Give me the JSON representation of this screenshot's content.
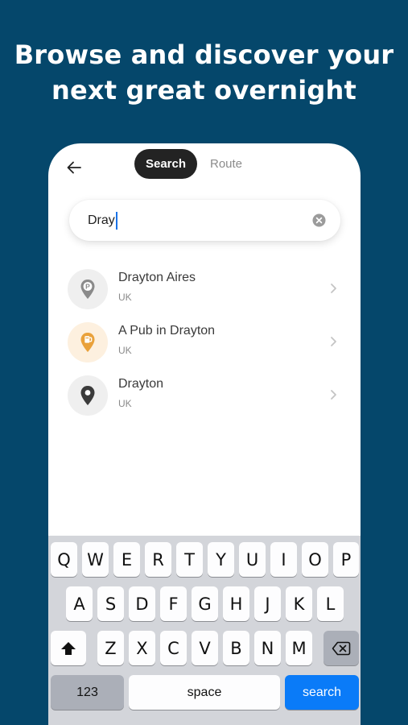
{
  "headline": {
    "line1": "Browse and discover your",
    "line2": "next great overnight"
  },
  "header": {
    "tabs": [
      {
        "label": "Search",
        "active": true
      },
      {
        "label": "Route",
        "active": false
      }
    ]
  },
  "search": {
    "value": "Dray"
  },
  "results": [
    {
      "title": "Drayton Aires",
      "subtitle": "UK",
      "icon": "parking-pin-icon",
      "bg": "#efefef",
      "color": "#8a8a8a"
    },
    {
      "title": "A Pub in Drayton",
      "subtitle": "UK",
      "icon": "pub-pin-icon",
      "bg": "#fdf0df",
      "color": "#e9a13b"
    },
    {
      "title": "Drayton",
      "subtitle": "UK",
      "icon": "location-pin-icon",
      "bg": "#efefef",
      "color": "#3b3b3b"
    }
  ],
  "keyboard": {
    "row1": [
      "Q",
      "W",
      "E",
      "R",
      "T",
      "Y",
      "U",
      "I",
      "O",
      "P"
    ],
    "row2": [
      "A",
      "S",
      "D",
      "F",
      "G",
      "H",
      "J",
      "K",
      "L"
    ],
    "row3": [
      "Z",
      "X",
      "C",
      "V",
      "B",
      "N",
      "M"
    ],
    "numbers_label": "123",
    "space_label": "space",
    "search_label": "search"
  }
}
